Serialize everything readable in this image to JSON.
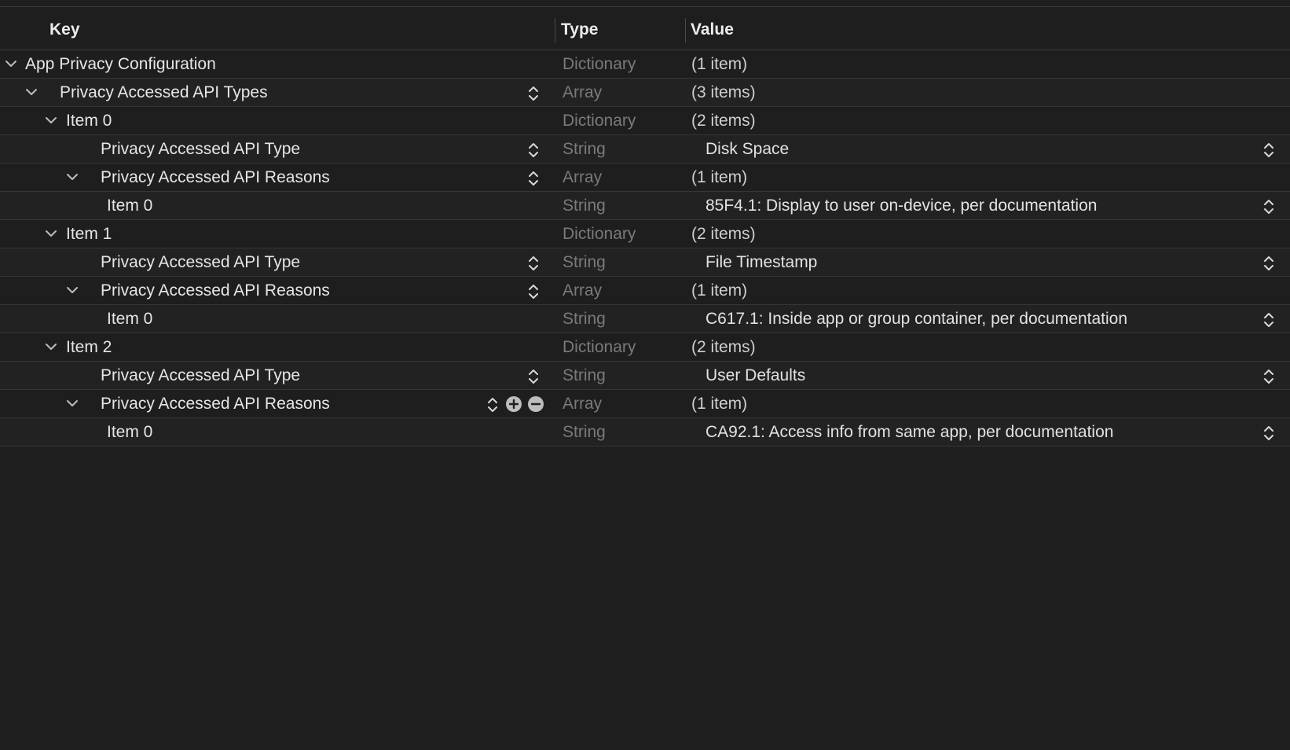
{
  "columns": {
    "key": "Key",
    "type": "Type",
    "value": "Value"
  },
  "rows": [
    {
      "key": "App Privacy Configuration",
      "type": "Dictionary",
      "value": "(1 item)"
    },
    {
      "key": "Privacy Accessed API Types",
      "type": "Array",
      "value": "(3 items)"
    },
    {
      "key": "Item 0",
      "type": "Dictionary",
      "value": "(2 items)"
    },
    {
      "key": "Privacy Accessed API Type",
      "type": "String",
      "value": "Disk Space"
    },
    {
      "key": "Privacy Accessed API Reasons",
      "type": "Array",
      "value": "(1 item)"
    },
    {
      "key": "Item 0",
      "type": "String",
      "value": "85F4.1: Display to user on-device, per documentation"
    },
    {
      "key": "Item 1",
      "type": "Dictionary",
      "value": "(2 items)"
    },
    {
      "key": "Privacy Accessed API Type",
      "type": "String",
      "value": "File Timestamp"
    },
    {
      "key": "Privacy Accessed API Reasons",
      "type": "Array",
      "value": "(1 item)"
    },
    {
      "key": "Item 0",
      "type": "String",
      "value": "C617.1: Inside app or group container, per documentation"
    },
    {
      "key": "Item 2",
      "type": "Dictionary",
      "value": "(2 items)"
    },
    {
      "key": "Privacy Accessed API Type",
      "type": "String",
      "value": "User Defaults"
    },
    {
      "key": "Privacy Accessed API Reasons",
      "type": "Array",
      "value": "(1 item)"
    },
    {
      "key": "Item 0",
      "type": "String",
      "value": "CA92.1: Access info from same app, per documentation"
    }
  ],
  "icons": {
    "disclosure": "chevron-down-icon",
    "stepper": "up-down-stepper-icon",
    "add": "plus-circle-icon",
    "remove": "minus-circle-icon"
  },
  "colors": {
    "background": "#1e1e1e",
    "text": "#e6e6e6",
    "type_text": "#7a7a7a",
    "divider": "#363636"
  }
}
